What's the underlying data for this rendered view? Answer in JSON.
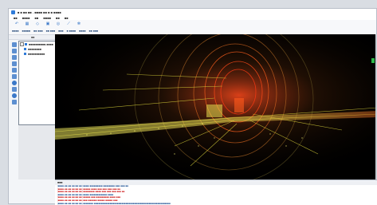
{
  "window": {
    "title": "■ ■ ■■ ■■ - ■■■■ ■■ ■ ■ ■■■■"
  },
  "menu": {
    "items": [
      "■■",
      "■■■■",
      "■■",
      "■■■■",
      "■■",
      "■■"
    ]
  },
  "toolbar": {
    "buttons": [
      {
        "icon": "undo-icon",
        "glyph": "↶",
        "color": "#3a78c8"
      },
      {
        "icon": "grid-icon",
        "glyph": "▦",
        "color": "#3a78c8"
      },
      {
        "icon": "layers-icon",
        "glyph": "◇",
        "color": "#3a78c8"
      },
      {
        "icon": "save-icon",
        "glyph": "▣",
        "color": "#3a78c8"
      },
      {
        "icon": "target-icon",
        "glyph": "◎",
        "color": "#3a78c8"
      },
      {
        "icon": "measure-icon",
        "glyph": "⟋",
        "color": "#3a78c8"
      },
      {
        "icon": "settings-icon",
        "glyph": "✻",
        "color": "#3a78c8"
      }
    ]
  },
  "subtoolbar": {
    "items": [
      "■■■■",
      "■■■■■",
      "■■ ■■■",
      "■■ ■■■",
      "■■■",
      "■ ■■■■",
      "■■■■",
      "■■ ■■■"
    ]
  },
  "panels": {
    "left_header": "■■",
    "right_header": "■■"
  },
  "tree": {
    "items": [
      {
        "label": "■■■■■■■■■■-■■■■"
      },
      {
        "label": "■■■■■■■■"
      },
      {
        "label": "■■■■■■■■■■"
      }
    ]
  },
  "log": {
    "header": "■■■",
    "lines": [
      {
        "text": "[■■■■-■■-■■ ■■:■■:■■] ■■■■ ■■■■■■■■■ ■■■■■■■■ ■■■ ■■■ ■■",
        "kind": "info"
      },
      {
        "text": "[■■■■-■■-■■ ■■:■■:■■] ■■■■■ ■■■■ ■■■ ■■■ ■■■ ■■■ ■■",
        "kind": "error"
      },
      {
        "text": "[■■■■-■■-■■ ■■:■■:■■] ■■■■■■■■ ■■■■ ■■■ ■■■ ■■■ ■■■ ■■",
        "kind": "error"
      },
      {
        "text": "[■■■■-■■-■■ ■■:■■:■■] ■■■■ ■■■■■■■■■■■■ ■■■■",
        "kind": "info"
      },
      {
        "text": "[■■■■-■■-■■ ■■:■■:■■] ■■■■■ ■■■ ■■■■■■■■■ ■■■■ ■■■",
        "kind": "error"
      },
      {
        "text": "[■■■■-■■-■■ ■■:■■:■■] ■■■ ■■■■■■ ■■■■■ ■■■■■ ■■■",
        "kind": "error"
      },
      {
        "text": "[■■■■-■■-■■ ■■:■■:■■] ■■■■■■■ ■■■■■■■■■■■■■■■■■■■■■■■■■■■■■■■■■■■■■■■■■■■■■■■■■■■■■",
        "kind": "info"
      }
    ]
  },
  "colors": {
    "accent": "#2f7bd8",
    "error": "#d22b2b",
    "info": "#2d5d9b"
  }
}
